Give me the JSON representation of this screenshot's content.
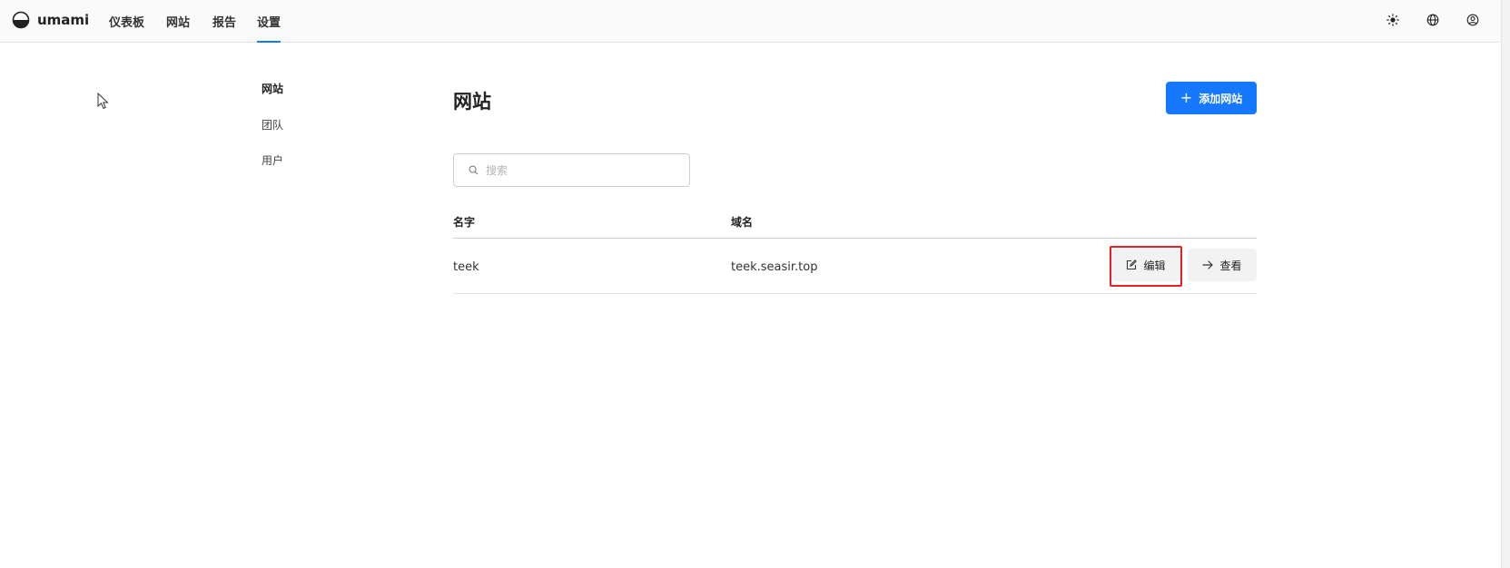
{
  "app": {
    "name": "umami"
  },
  "nav": {
    "items": [
      {
        "label": "仪表板"
      },
      {
        "label": "网站"
      },
      {
        "label": "报告"
      },
      {
        "label": "设置"
      }
    ],
    "active": "设置"
  },
  "top_icons": [
    "sun-icon",
    "globe-icon",
    "user-circle-icon"
  ],
  "settings_menu": {
    "items": [
      {
        "label": "网站"
      },
      {
        "label": "团队"
      },
      {
        "label": "用户"
      }
    ],
    "active": "网站"
  },
  "main": {
    "title": "网站",
    "add_button": {
      "icon": "plus-icon",
      "label": "添加网站"
    },
    "search": {
      "placeholder": "搜索",
      "value": ""
    },
    "table": {
      "columns": [
        "名字",
        "域名"
      ],
      "rows": [
        {
          "name": "teek",
          "domain": "teek.seasir.top",
          "edit_label": "编辑",
          "view_label": "查看"
        }
      ]
    }
  },
  "colors": {
    "accent": "#1677ff",
    "highlight": "#e82020"
  }
}
